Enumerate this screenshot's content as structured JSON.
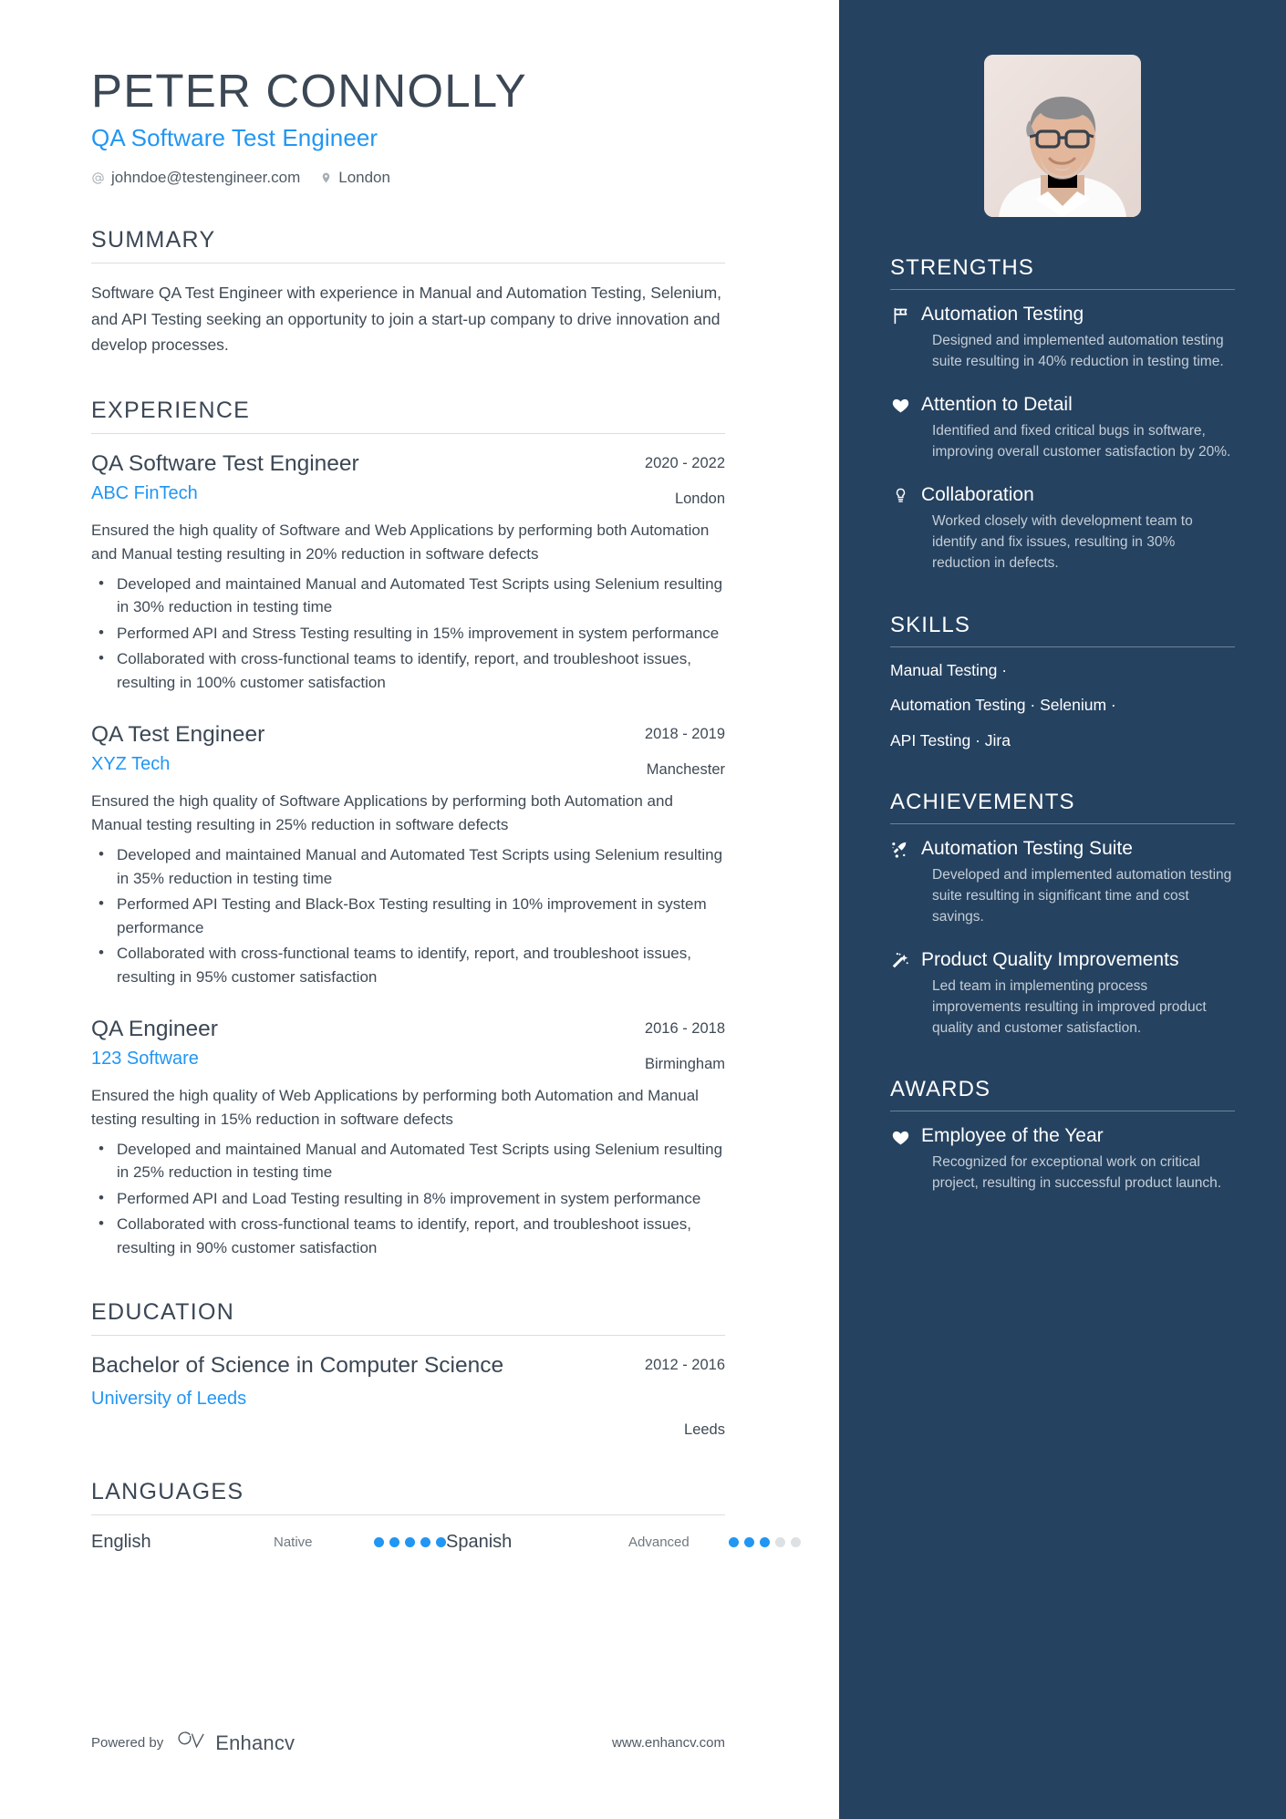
{
  "header": {
    "name": "PETER CONNOLLY",
    "title": "QA Software Test Engineer",
    "email": "johndoe@testengineer.com",
    "email_icon": "at-icon",
    "location": "London",
    "location_icon": "map-pin-icon"
  },
  "summary": {
    "heading": "SUMMARY",
    "text": "Software QA Test Engineer with experience in Manual and Automation Testing, Selenium, and API Testing seeking an opportunity to join a start-up company to drive innovation and develop processes."
  },
  "experience": {
    "heading": "EXPERIENCE",
    "entries": [
      {
        "role": "QA Software Test Engineer",
        "org": "ABC FinTech",
        "date": "2020 - 2022",
        "location": "London",
        "desc": "Ensured the high quality of Software and Web Applications by performing both Automation and Manual testing resulting in 20% reduction in software defects",
        "bullets": [
          "Developed and maintained Manual and Automated Test Scripts using Selenium resulting in 30% reduction in testing time",
          "Performed API and Stress Testing resulting in 15% improvement in system performance",
          "Collaborated with cross-functional teams to identify, report, and troubleshoot issues, resulting in 100% customer satisfaction"
        ]
      },
      {
        "role": "QA Test Engineer",
        "org": "XYZ Tech",
        "date": "2018 - 2019",
        "location": "Manchester",
        "desc": "Ensured the high quality of Software Applications by performing both Automation and Manual testing resulting in 25% reduction in software defects",
        "bullets": [
          "Developed and maintained Manual and Automated Test Scripts using Selenium resulting in 35% reduction in testing time",
          "Performed API Testing and Black-Box Testing resulting in 10% improvement in system performance",
          "Collaborated with cross-functional teams to identify, report, and troubleshoot issues, resulting in 95% customer satisfaction"
        ]
      },
      {
        "role": "QA Engineer",
        "org": "123 Software",
        "date": "2016 - 2018",
        "location": "Birmingham",
        "desc": "Ensured the high quality of Web Applications by performing both Automation and Manual testing resulting in 15% reduction in software defects",
        "bullets": [
          "Developed and maintained Manual and Automated Test Scripts using Selenium resulting in 25% reduction in testing time",
          "Performed API and Load Testing resulting in 8% improvement in system performance",
          "Collaborated with cross-functional teams to identify, report, and troubleshoot issues, resulting in 90% customer satisfaction"
        ]
      }
    ]
  },
  "education": {
    "heading": "EDUCATION",
    "entries": [
      {
        "degree": "Bachelor of Science in Computer Science",
        "school": "University of Leeds",
        "date": "2012 - 2016",
        "location": "Leeds"
      }
    ]
  },
  "languages": {
    "heading": "LANGUAGES",
    "items": [
      {
        "name": "English",
        "level": "Native",
        "filled": 5,
        "total": 5
      },
      {
        "name": "Spanish",
        "level": "Advanced",
        "filled": 3,
        "total": 5
      }
    ]
  },
  "footer": {
    "powered_by": "Powered by",
    "brand": "Enhancv",
    "brand_icon": "enhancv-logo-icon",
    "url": "www.enhancv.com"
  },
  "sidebar": {
    "photo_alt": "profile-photo",
    "strengths": {
      "heading": "STRENGTHS",
      "items": [
        {
          "icon": "flag-icon",
          "title": "Automation Testing",
          "desc": "Designed and implemented automation testing suite resulting in 40% reduction in testing time."
        },
        {
          "icon": "heart-icon",
          "title": "Attention to Detail",
          "desc": "Identified and fixed critical bugs in software, improving overall customer satisfaction by 20%."
        },
        {
          "icon": "lightbulb-icon",
          "title": "Collaboration",
          "desc": "Worked closely with development team to identify and fix issues, resulting in 30% reduction in defects."
        }
      ]
    },
    "skills": {
      "heading": "SKILLS",
      "lines": [
        "Manual Testing ·",
        "Automation Testing · Selenium ·",
        "API Testing · Jira"
      ]
    },
    "achievements": {
      "heading": "ACHIEVEMENTS",
      "items": [
        {
          "icon": "rocket-icon",
          "title": "Automation Testing Suite",
          "desc": "Developed and implemented automation testing suite resulting in significant time and cost savings."
        },
        {
          "icon": "magic-wand-icon",
          "title": "Product Quality Improvements",
          "desc": "Led team in implementing process improvements resulting in improved product quality and customer satisfaction."
        }
      ]
    },
    "awards": {
      "heading": "AWARDS",
      "items": [
        {
          "icon": "heart-icon",
          "title": "Employee of the Year",
          "desc": "Recognized for exceptional work on critical project, resulting in successful product launch."
        }
      ]
    }
  },
  "colors": {
    "sidebar_bg": "#254260",
    "accent_blue": "#2196f3",
    "heading_dark": "#3b4754",
    "body_text": "#3f4a55",
    "muted": "#c4cdd6"
  }
}
